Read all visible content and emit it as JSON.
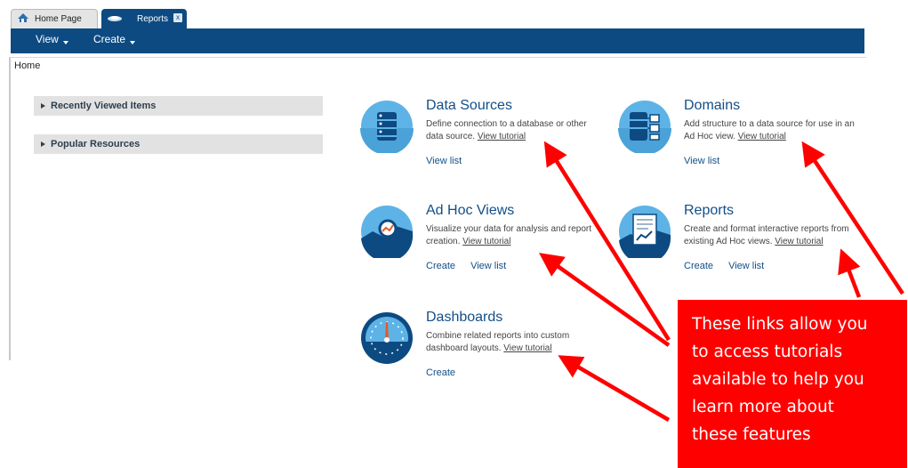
{
  "tabs": [
    {
      "label": "Home Page",
      "active": false
    },
    {
      "label": "Reports",
      "active": true,
      "close_glyph": "x"
    }
  ],
  "nav": {
    "view_label": "View",
    "create_label": "Create"
  },
  "breadcrumb": "Home",
  "side_panels": [
    {
      "label": "Recently Viewed Items"
    },
    {
      "label": "Popular Resources"
    }
  ],
  "features": {
    "data_sources": {
      "title": "Data Sources",
      "desc": "Define connection to a database or other data source.",
      "tutorial": "View tutorial",
      "links": [
        "View list"
      ],
      "icon": "database-icon"
    },
    "domains": {
      "title": "Domains",
      "desc": "Add structure to a data source for use in an Ad Hoc view.",
      "tutorial": "View tutorial",
      "links": [
        "View list"
      ],
      "icon": "domain-icon"
    },
    "adhoc": {
      "title": "Ad Hoc Views",
      "desc": "Visualize your data for analysis and report creation.",
      "tutorial": "View tutorial",
      "links": [
        "Create",
        "View list"
      ],
      "icon": "magnifier-chart-icon"
    },
    "reports": {
      "title": "Reports",
      "desc": "Create and format interactive reports from existing Ad Hoc views.",
      "tutorial": "View tutorial",
      "links": [
        "Create",
        "View list"
      ],
      "icon": "report-document-icon"
    },
    "dashboards": {
      "title": "Dashboards",
      "desc": "Combine related reports into custom dashboard layouts.",
      "tutorial": "View tutorial",
      "links": [
        "Create"
      ],
      "icon": "gauge-icon"
    }
  },
  "callout": {
    "lines": [
      "These links allow you",
      "to access tutorials",
      "available to help you",
      "learn more about",
      "these features"
    ],
    "color": "#ff0000"
  },
  "colors": {
    "nav_bar": "#0d4a82",
    "title_blue": "#124f88",
    "icon_circle": "#5eb3e6"
  }
}
